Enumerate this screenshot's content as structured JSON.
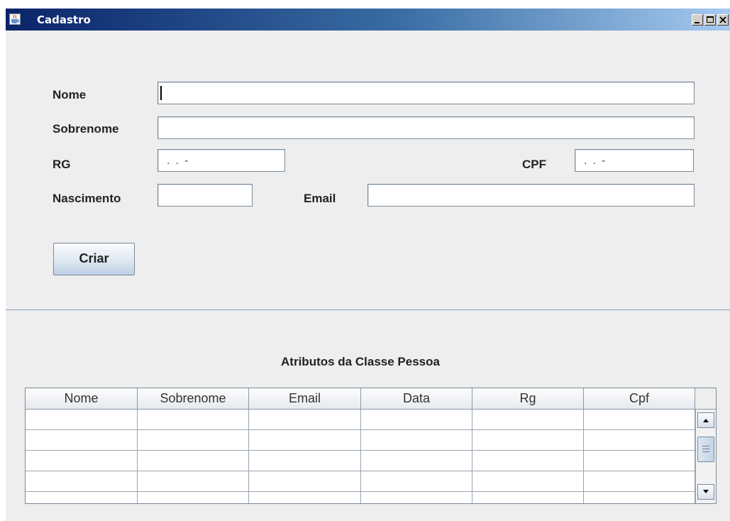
{
  "window": {
    "title": "Cadastro",
    "title_bar_colors": [
      "#0a246a",
      "#3a6ea5",
      "#a6caf0"
    ]
  },
  "form": {
    "nome_label": "Nome",
    "nome_value": "",
    "sobrenome_label": "Sobrenome",
    "sobrenome_value": "",
    "rg_label": "RG",
    "rg_value": " .  .  -",
    "cpf_label": "CPF",
    "cpf_value": " .  .  -",
    "nascimento_label": "Nascimento",
    "nascimento_value": "",
    "email_label": "Email",
    "email_value": "",
    "criar_button": "Criar"
  },
  "table": {
    "title": "Atributos da Classe Pessoa",
    "columns": [
      "Nome",
      "Sobrenome",
      "Email",
      "Data",
      "Rg",
      "Cpf"
    ],
    "rows": [
      [
        "",
        "",
        "",
        "",
        "",
        ""
      ],
      [
        "",
        "",
        "",
        "",
        "",
        ""
      ],
      [
        "",
        "",
        "",
        "",
        "",
        ""
      ],
      [
        "",
        "",
        "",
        "",
        "",
        ""
      ],
      [
        "",
        "",
        "",
        "",
        "",
        ""
      ]
    ]
  },
  "icons": {
    "app": "java-coffee-cup-icon",
    "minimize": "minimize-icon",
    "maximize": "maximize-icon",
    "close": "close-icon",
    "scroll_up": "arrow-up-icon",
    "scroll_down": "arrow-down-icon"
  }
}
